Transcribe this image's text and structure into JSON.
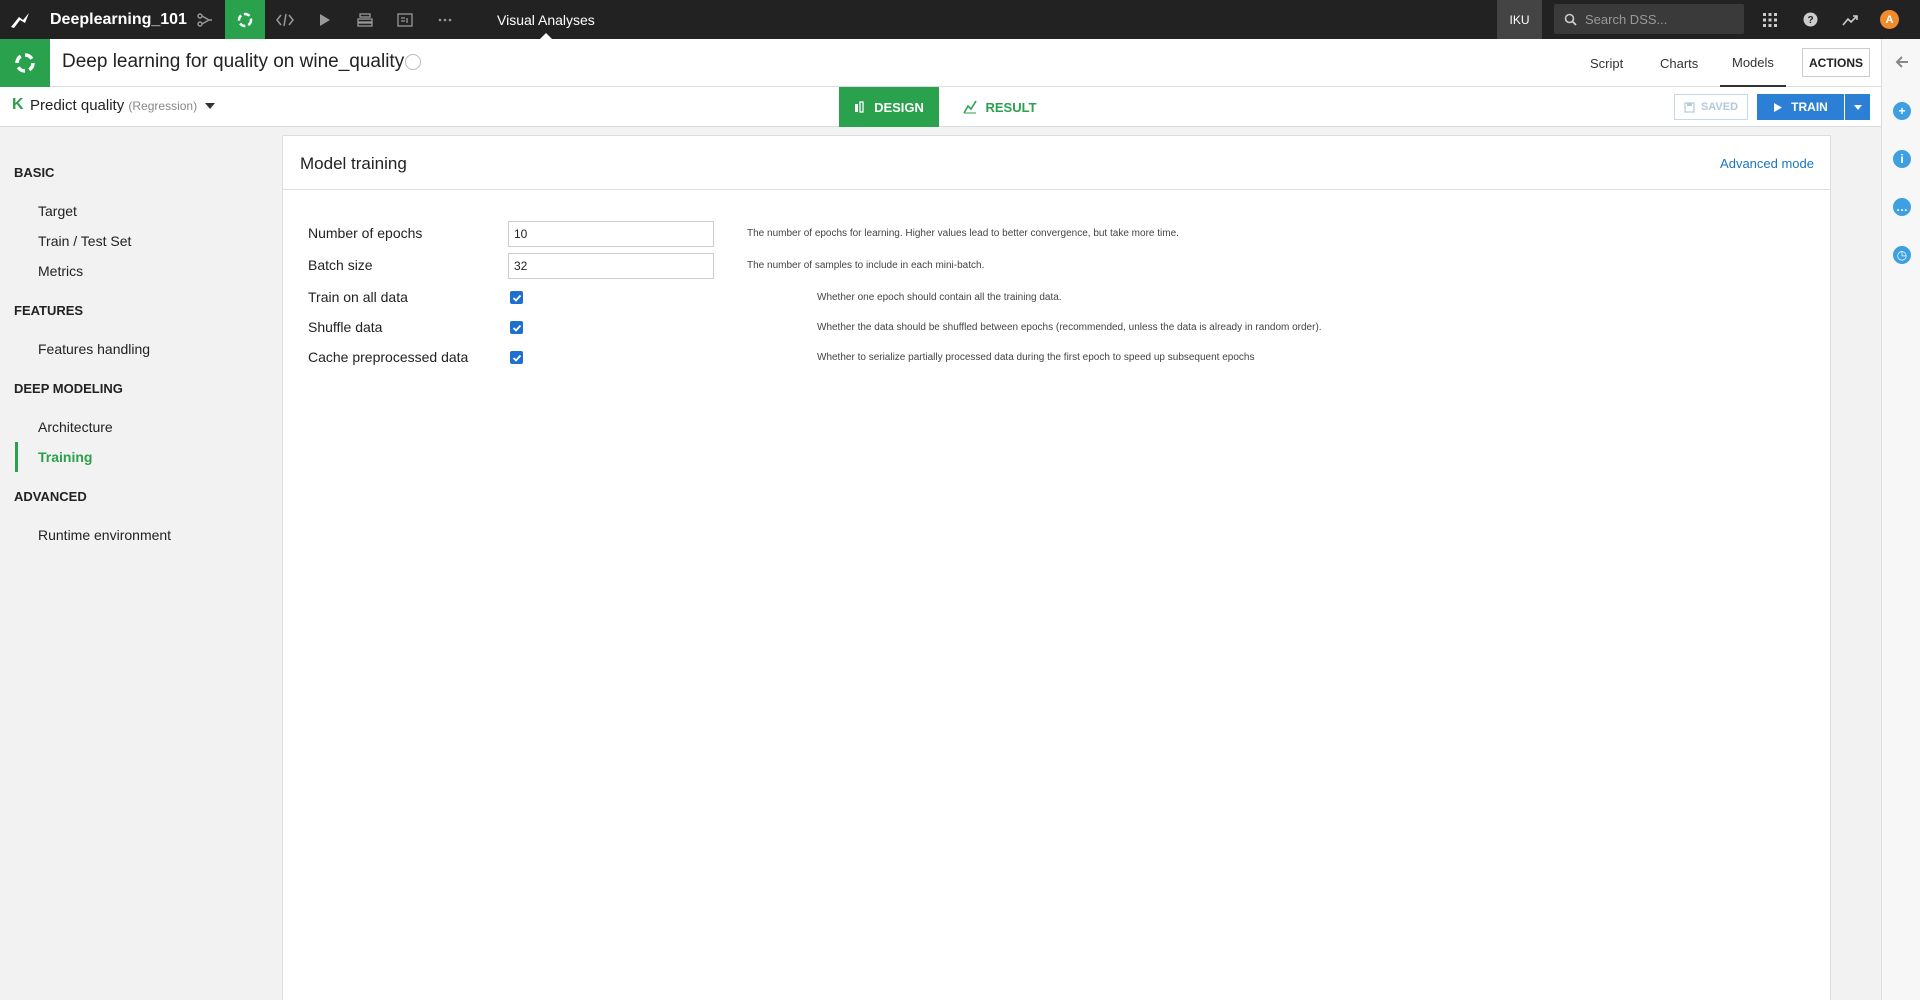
{
  "topnav": {
    "project_name": "Deeplearning_101",
    "section_title": "Visual Analyses",
    "instance_label": "IKU",
    "search_placeholder": "Search DSS...",
    "avatar_letter": "A",
    "icons": [
      "flow-icon",
      "lab-icon",
      "code-icon",
      "run-icon",
      "stack-icon",
      "dashboard-icon",
      "more-icon",
      "apps-grid-icon",
      "help-icon",
      "activity-icon"
    ]
  },
  "header": {
    "title": "Deep learning for quality on wine_quality",
    "tabs": [
      {
        "label": "Script"
      },
      {
        "label": "Charts"
      },
      {
        "label": "Models"
      }
    ],
    "active_tab": "Models",
    "actions_label": "ACTIONS"
  },
  "subheader": {
    "prediction_label": "Predict quality",
    "prediction_mode": "(Regression)",
    "design_label": "DESIGN",
    "result_label": "RESULT",
    "saved_label": "SAVED",
    "train_label": "TRAIN"
  },
  "sidebar": {
    "sections": [
      {
        "title": "BASIC",
        "items": [
          {
            "label": "Target"
          },
          {
            "label": "Train / Test Set"
          },
          {
            "label": "Metrics"
          }
        ]
      },
      {
        "title": "FEATURES",
        "items": [
          {
            "label": "Features handling"
          }
        ]
      },
      {
        "title": "DEEP MODELING",
        "items": [
          {
            "label": "Architecture"
          },
          {
            "label": "Training"
          }
        ]
      },
      {
        "title": "ADVANCED",
        "items": [
          {
            "label": "Runtime environment"
          }
        ]
      }
    ],
    "active_item": "Training"
  },
  "card": {
    "title": "Model training",
    "advanced_link": "Advanced mode",
    "fields": [
      {
        "label": "Number of epochs",
        "value": "10",
        "help": "The number of epochs for learning. Higher values lead to better convergence, but take more time."
      },
      {
        "label": "Batch size",
        "value": "32",
        "help": "The number of samples to include in each mini-batch."
      },
      {
        "label": "Train on all data",
        "checked": true,
        "help": "Whether one epoch should contain all the training data."
      },
      {
        "label": "Shuffle data",
        "checked": true,
        "help": "Whether the data should be shuffled between epochs (recommended, unless the data is already in random order)."
      },
      {
        "label": "Cache preprocessed data",
        "checked": true,
        "help": "Whether to serialize partially processed data during the first epoch to speed up subsequent epochs"
      }
    ]
  },
  "colors": {
    "accent_green": "#2aa14c",
    "primary_blue": "#2b7fd4",
    "link_blue": "#1a76c2",
    "topbar": "#222222"
  }
}
